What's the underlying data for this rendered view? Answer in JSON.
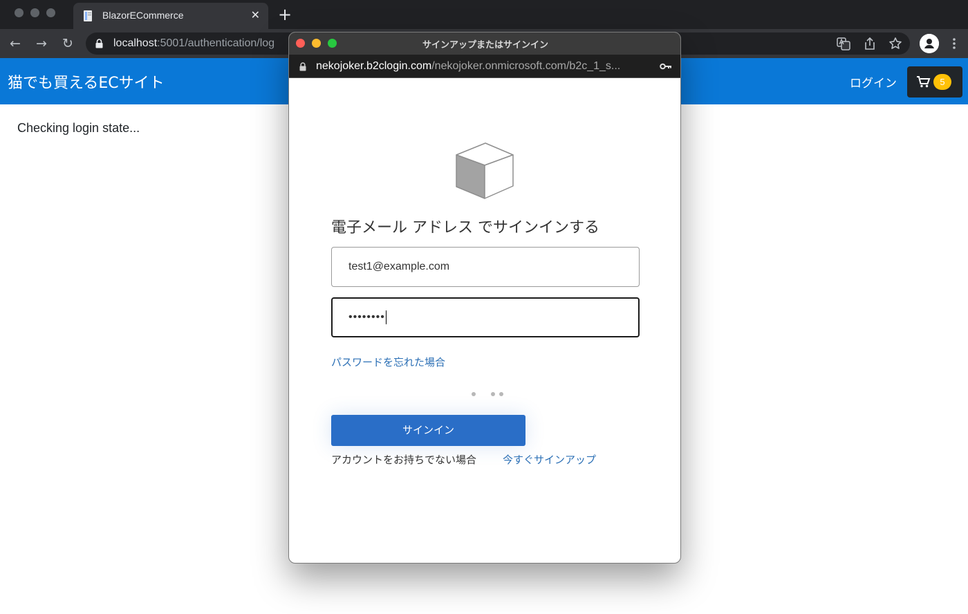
{
  "browser": {
    "tab": {
      "title": "BlazorECommerce",
      "close_glyph": "✕"
    },
    "new_tab_glyph": "+",
    "nav": {
      "back_glyph": "←",
      "forward_glyph": "→",
      "reload_glyph": "↻"
    },
    "address": {
      "host": "localhost",
      "rest": ":5001/authentication/log"
    },
    "icons": [
      "lock-icon",
      "translate-icon",
      "share-icon",
      "star-icon",
      "profile-icon",
      "more-menu-icon"
    ]
  },
  "page": {
    "brand": "猫でも買えるECサイト",
    "login_label": "ログイン",
    "cart_count": "5",
    "status": "Checking login state...",
    "colors": {
      "appbar": "#0a78d7",
      "cart_button": "#212529",
      "badge": "#ffc107"
    }
  },
  "popup": {
    "window_title": "サインアップまたはサインイン",
    "url": {
      "host": "nekojoker.b2clogin.com",
      "rest": "/nekojoker.onmicrosoft.com/b2c_1_s..."
    },
    "heading": "電子メール アドレス でサインインする",
    "email_value": "test1@example.com",
    "password_mask": "••••••••",
    "forgot_password": "パスワードを忘れた場合",
    "signin_button": "サインイン",
    "no_account_text": "アカウントをお持ちでない場合",
    "signup_link": "今すぐサインアップ",
    "colors": {
      "button": "#2a6ec7",
      "link": "#2b6fb5"
    }
  }
}
